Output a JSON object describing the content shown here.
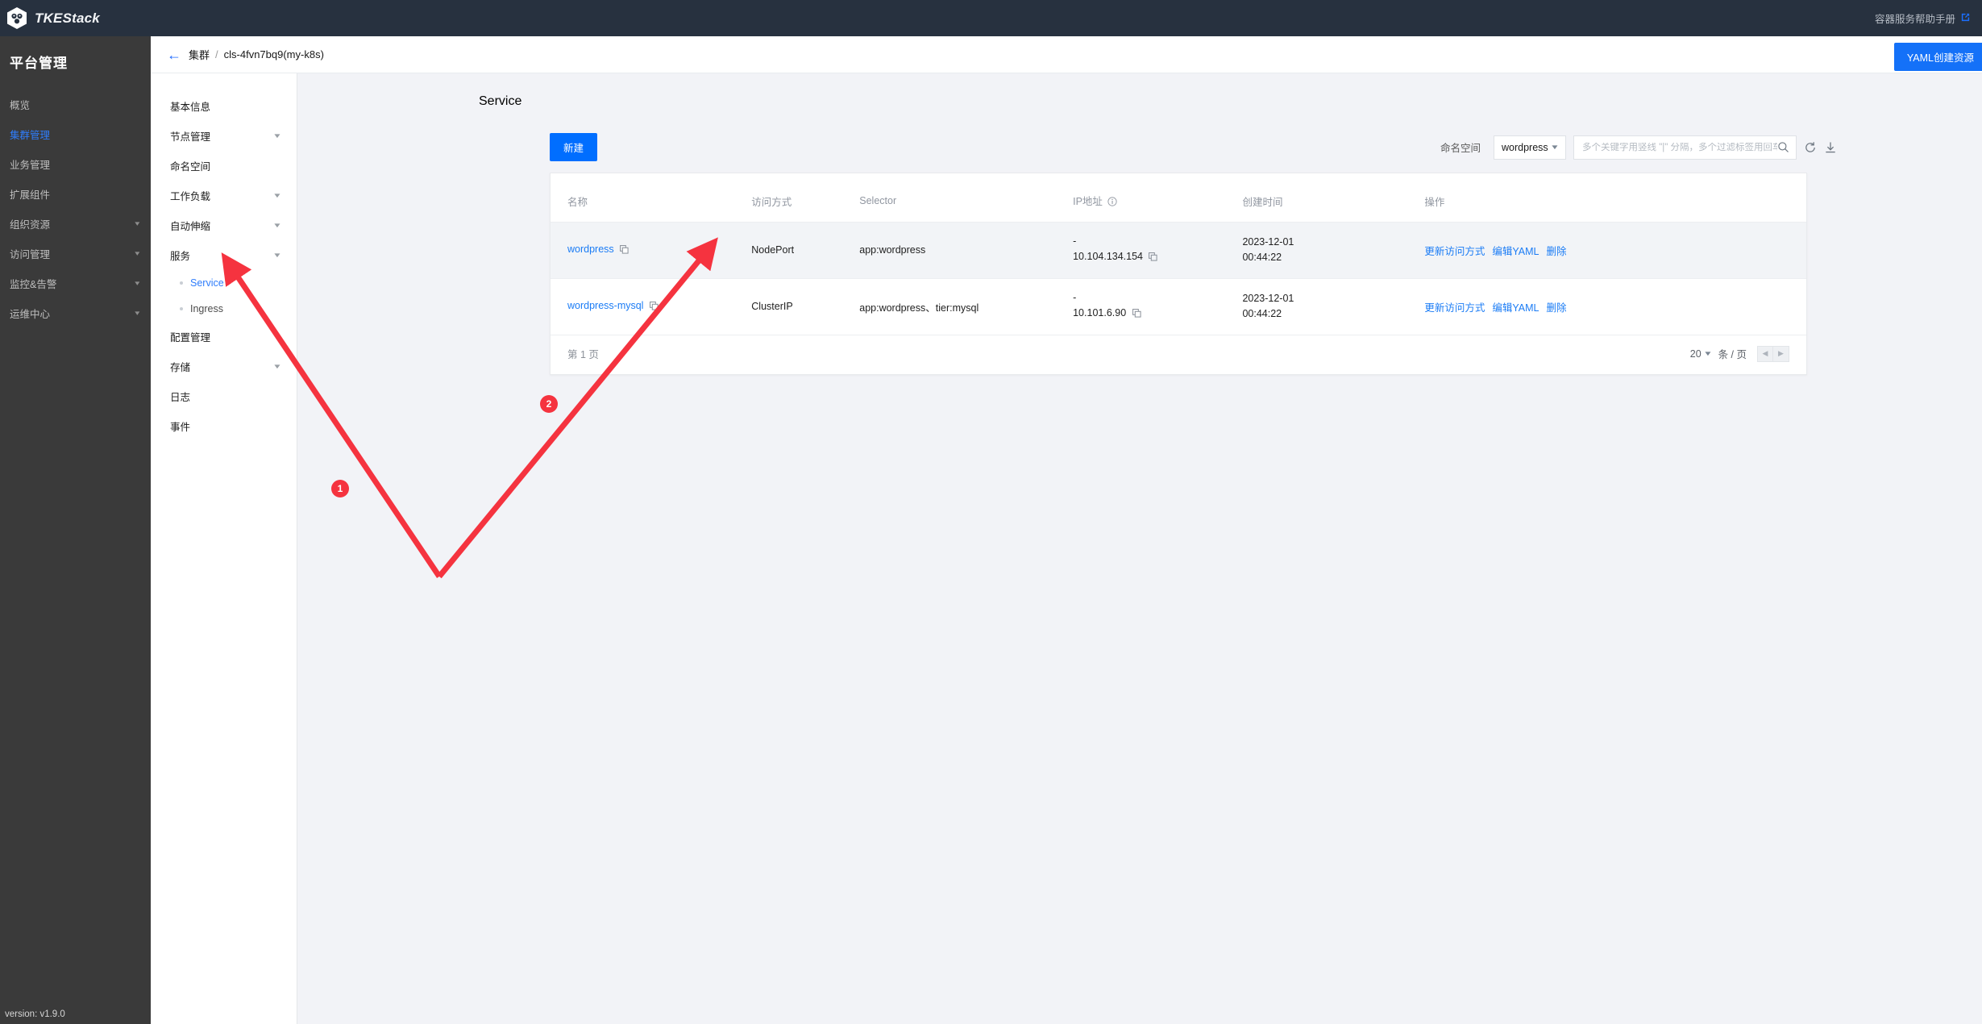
{
  "topbar": {
    "brand": "TKEStack",
    "help_link": "容器服务帮助手册",
    "external_icon": "external-link-icon"
  },
  "sidebar": {
    "title": "平台管理",
    "version": "version: v1.9.0",
    "items": [
      {
        "label": "概览",
        "expandable": false,
        "active": false
      },
      {
        "label": "集群管理",
        "expandable": false,
        "active": true
      },
      {
        "label": "业务管理",
        "expandable": false,
        "active": false
      },
      {
        "label": "扩展组件",
        "expandable": false,
        "active": false
      },
      {
        "label": "组织资源",
        "expandable": true,
        "active": false
      },
      {
        "label": "访问管理",
        "expandable": true,
        "active": false
      },
      {
        "label": "监控&告警",
        "expandable": true,
        "active": false
      },
      {
        "label": "运维中心",
        "expandable": true,
        "active": false
      }
    ]
  },
  "breadcrumb": {
    "back_icon": "back-arrow-icon",
    "parent": "集群",
    "separator": "/",
    "current": "cls-4fvn7bq9(my-k8s)",
    "yaml_button": "YAML创建资源"
  },
  "subnav": {
    "items": [
      {
        "label": "基本信息",
        "expandable": false
      },
      {
        "label": "节点管理",
        "expandable": true
      },
      {
        "label": "命名空间",
        "expandable": false
      },
      {
        "label": "工作负载",
        "expandable": true
      },
      {
        "label": "自动伸缩",
        "expandable": true
      },
      {
        "label": "服务",
        "expandable": true
      }
    ],
    "service_children": [
      {
        "label": "Service",
        "active": true
      },
      {
        "label": "Ingress",
        "active": false
      }
    ],
    "items_after": [
      {
        "label": "配置管理",
        "expandable": true
      },
      {
        "label": "存储",
        "expandable": true
      },
      {
        "label": "日志",
        "expandable": false
      },
      {
        "label": "事件",
        "expandable": false
      }
    ]
  },
  "main": {
    "page_title": "Service",
    "create_button": "新建",
    "namespace_label": "命名空间",
    "namespace_value": "wordpress",
    "search_placeholder": "多个关键字用竖线 \"|\" 分隔，多个过滤标签用回车键"
  },
  "table": {
    "columns": [
      "名称",
      "访问方式",
      "Selector",
      "IP地址",
      "创建时间",
      "操作"
    ],
    "rows": [
      {
        "name": "wordpress",
        "access_type": "NodePort",
        "selector": "app:wordpress",
        "ip_first": "-",
        "ip_second": "10.104.134.154",
        "created_date": "2023-12-01",
        "created_time": "00:44:22",
        "ops": [
          "更新访问方式",
          "编辑YAML",
          "删除"
        ],
        "highlighted": true
      },
      {
        "name": "wordpress-mysql",
        "access_type": "ClusterIP",
        "selector": "app:wordpress、tier:mysql",
        "ip_first": "-",
        "ip_second": "10.101.6.90",
        "created_date": "2023-12-01",
        "created_time": "00:44:22",
        "ops": [
          "更新访问方式",
          "编辑YAML",
          "删除"
        ],
        "highlighted": false
      }
    ]
  },
  "pagination": {
    "page_label": "第 1 页",
    "page_size": "20",
    "page_size_unit": "条 / 页",
    "prev_icon": "chevron-left-icon",
    "next_icon": "chevron-right-icon"
  },
  "annotations": [
    {
      "number": "1"
    },
    {
      "number": "2"
    }
  ],
  "colors": {
    "accent": "#006eff",
    "link": "#1b7cf5",
    "topbar_bg": "#27313f",
    "sidebar_bg": "#3a3a3a",
    "annotation": "#f5333f",
    "page_bg": "#f2f3f7"
  }
}
